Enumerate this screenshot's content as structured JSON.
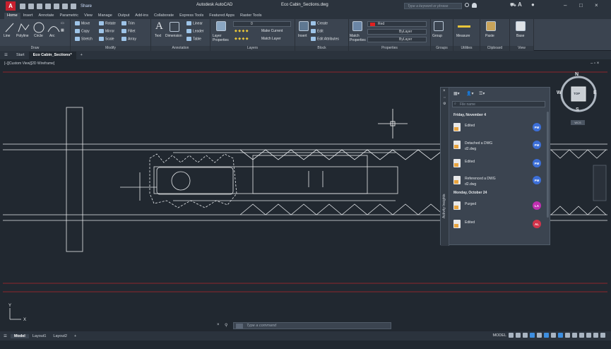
{
  "window": {
    "app_name": "Autodesk AutoCAD",
    "file_name": "Eco Cabin_Sections.dwg",
    "app_letter": "A",
    "share": "Share",
    "search_placeholder": "Type a keyword or phrase",
    "min": "–",
    "max": "□",
    "close": "×"
  },
  "ribbon_tabs": [
    "Home",
    "Insert",
    "Annotate",
    "Parametric",
    "View",
    "Manage",
    "Output",
    "Add-ins",
    "Collaborate",
    "Express Tools",
    "Featured Apps",
    "Raster Tools"
  ],
  "ribbon": {
    "draw": {
      "title": "Draw",
      "line": "Line",
      "polyline": "Polyline",
      "circle": "Circle",
      "arc": "Arc"
    },
    "modify": {
      "title": "Modify",
      "move": "Move",
      "rotate": "Rotate",
      "trim": "Trim",
      "copy": "Copy",
      "mirror": "Mirror",
      "fillet": "Fillet",
      "stretch": "Stretch",
      "scale": "Scale",
      "array": "Array"
    },
    "annotation": {
      "title": "Annotation",
      "text": "Text",
      "dimension": "Dimension",
      "linear": "Linear",
      "leader": "Leader",
      "table": "Table"
    },
    "layers": {
      "title": "Layers",
      "layer_properties": "Layer Properties",
      "layer_value": "0",
      "make_current": "Make Current",
      "match_layer": "Match Layer"
    },
    "block": {
      "title": "Block",
      "insert": "Insert",
      "create": "Create",
      "edit": "Edit",
      "edit_attributes": "Edit Attributes"
    },
    "properties": {
      "title": "Properties",
      "match_properties": "Match Properties",
      "color": "Red",
      "linetype": "ByLayer",
      "lineweight": "ByLayer"
    },
    "groups": {
      "title": "Groups",
      "group": "Group"
    },
    "utilities": {
      "title": "Utilities",
      "measure": "Measure"
    },
    "clipboard": {
      "title": "Clipboard",
      "paste": "Paste"
    },
    "view": {
      "title": "View",
      "base": "Base"
    }
  },
  "file_tabs": {
    "start": "Start",
    "active": "Eco Cabin_Sections*"
  },
  "viewport_label": "[–][Custom View][2D Wireframe]",
  "viewcube": {
    "n": "N",
    "s": "S",
    "e": "E",
    "w": "W",
    "top": "TOP",
    "wcs": "WCS"
  },
  "activity": {
    "title": "Activity Insights",
    "search_placeholder": "File name",
    "groups": [
      {
        "date": "Friday, November 4",
        "items": [
          {
            "text": "Edited",
            "user": "PM",
            "color": "#3c6fd8"
          },
          {
            "text": "Detached a DWG",
            "sub": "d2.dwg",
            "user": "PM",
            "color": "#3c6fd8"
          },
          {
            "text": "Edited",
            "user": "PM",
            "color": "#3c6fd8"
          },
          {
            "text": "Referenced a DWG",
            "sub": "d2.dwg",
            "user": "PM",
            "color": "#3c6fd8"
          }
        ]
      },
      {
        "date": "Monday, October 24",
        "items": [
          {
            "text": "Purged",
            "user": "LA",
            "color": "#c02fb0"
          },
          {
            "text": "Edited",
            "user": "AL",
            "color": "#d2334a"
          }
        ]
      }
    ]
  },
  "command": {
    "placeholder": "Type a command"
  },
  "status": {
    "model": "Model",
    "layout1": "Layout1",
    "layout2": "Layout2",
    "model_mode": "MODEL"
  }
}
